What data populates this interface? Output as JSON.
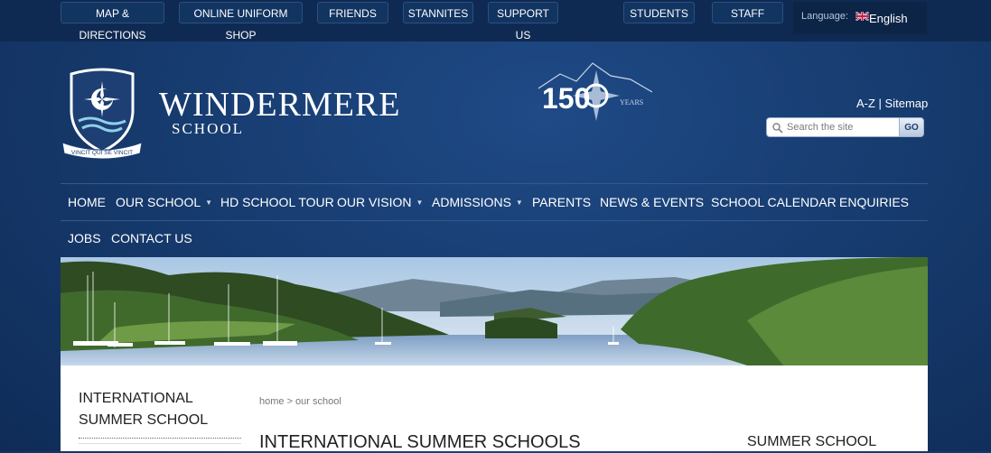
{
  "topbar": {
    "buttons": [
      "MAP & DIRECTIONS",
      "ONLINE UNIFORM SHOP",
      "FRIENDS",
      "STANNITES",
      "SUPPORT US",
      "STUDENTS",
      "STAFF"
    ],
    "language_label": "Language:",
    "language_value": "English"
  },
  "header": {
    "school_name": "WINDERMERE",
    "school_sub": "SCHOOL",
    "motto": "VINCIT QUI SE VINCIT",
    "anniversary_number": "150",
    "anniversary_word": "YEARS",
    "links": "A-Z | Sitemap",
    "search_placeholder": "Search the site",
    "go_label": "GO"
  },
  "nav": {
    "row1": [
      "HOME",
      "OUR SCHOOL",
      "HD SCHOOL TOUR",
      "OUR VISION",
      "ADMISSIONS",
      "PARENTS",
      "NEWS & EVENTS",
      "SCHOOL CALENDAR",
      "ENQUIRIES"
    ],
    "row2": [
      "JOBS",
      "CONTACT US"
    ]
  },
  "content": {
    "sidebar_title": "INTERNATIONAL SUMMER SCHOOL",
    "breadcrumb": "home > our school",
    "page_title": "INTERNATIONAL SUMMER SCHOOLS",
    "right_title": "SUMMER SCHOOL"
  }
}
